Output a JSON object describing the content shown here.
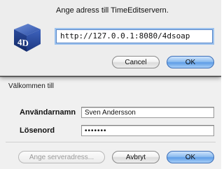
{
  "server_dialog": {
    "prompt": "Ange adress till TimeEditservern.",
    "address_value": "http://127.0.0.1:8080/4dsoap",
    "cancel_label": "Cancel",
    "ok_label": "OK",
    "icon": "4d-logo-icon"
  },
  "login": {
    "welcome": "Välkommen till",
    "username_label": "Användarnamn",
    "username_value": "Sven Andersson",
    "password_label": "Lösenord",
    "password_value": "•••••••",
    "server_button_label": "Ange serveradress...",
    "cancel_label": "Avbryt",
    "ok_label": "OK"
  },
  "colors": {
    "default_button": "#6aa6ea",
    "focus_ring": "#9cc2ee",
    "titlebar": "#4a4a4a"
  }
}
